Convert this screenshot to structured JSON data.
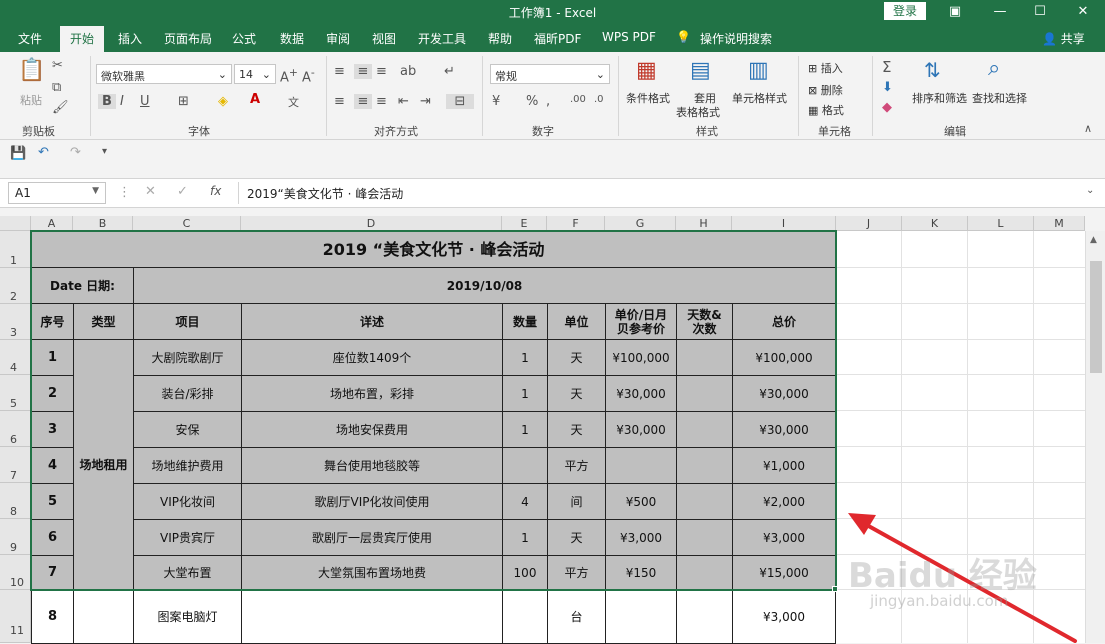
{
  "window": {
    "title": "工作簿1 - Excel",
    "login": "登录"
  },
  "tabs": [
    "文件",
    "开始",
    "插入",
    "页面布局",
    "公式",
    "数据",
    "审阅",
    "视图",
    "开发工具",
    "帮助",
    "福昕PDF",
    "WPS PDF",
    "操作说明搜索"
  ],
  "share": "共享",
  "ribbon": {
    "paste": "粘贴",
    "font_name": "微软雅黑",
    "font_size": "14",
    "number_format": "常规",
    "cond_format": "条件格式",
    "table_format_1": "套用",
    "table_format_2": "表格格式",
    "cell_style": "单元格样式",
    "insert": "插入",
    "delete": "删除",
    "format": "格式",
    "sort_filter": "排序和筛选",
    "find_select": "查找和选择",
    "groups": [
      "剪贴板",
      "字体",
      "对齐方式",
      "数字",
      "样式",
      "单元格",
      "编辑"
    ]
  },
  "formula_bar": {
    "name_box": "A1",
    "fx": "fx",
    "content": "2019“美食文化节 · 峰会活动"
  },
  "columns": [
    "A",
    "B",
    "C",
    "D",
    "E",
    "F",
    "G",
    "H",
    "I",
    "J",
    "K",
    "L",
    "M"
  ],
  "rows": [
    "1",
    "2",
    "3",
    "4",
    "5",
    "6",
    "7",
    "8",
    "9",
    "10",
    "11"
  ],
  "sheet": {
    "title": "2019 “美食文化节 · 峰会活动",
    "date_label": "Date   日期:",
    "date_value": "2019/10/08",
    "headers": [
      "序号",
      "类型",
      "项目",
      "详述",
      "数量",
      "单位",
      "单价/日月贝参考价",
      "天数&次数",
      "总价"
    ],
    "category": "场地租用",
    "items": [
      {
        "no": "1",
        "item": "大剧院歌剧厅",
        "detail": "座位数1409个",
        "qty": "1",
        "unit": "天",
        "price": "¥100,000",
        "days": "",
        "total": "¥100,000"
      },
      {
        "no": "2",
        "item": "装台/彩排",
        "detail": "场地布置，彩排",
        "qty": "1",
        "unit": "天",
        "price": "¥30,000",
        "days": "",
        "total": "¥30,000"
      },
      {
        "no": "3",
        "item": "安保",
        "detail": "场地安保费用",
        "qty": "1",
        "unit": "天",
        "price": "¥30,000",
        "days": "",
        "total": "¥30,000"
      },
      {
        "no": "4",
        "item": "场地维护费用",
        "detail": "舞台使用地毯胶等",
        "qty": "",
        "unit": "平方",
        "price": "",
        "days": "",
        "total": "¥1,000"
      },
      {
        "no": "5",
        "item": "VIP化妆间",
        "detail": "歌剧厅VIP化妆间使用",
        "qty": "4",
        "unit": "间",
        "price": "¥500",
        "days": "",
        "total": "¥2,000"
      },
      {
        "no": "6",
        "item": "VIP贵宾厅",
        "detail": "歌剧厅一层贵宾厅使用",
        "qty": "1",
        "unit": "天",
        "price": "¥3,000",
        "days": "",
        "total": "¥3,000"
      },
      {
        "no": "7",
        "item": "大堂布置",
        "detail": "大堂氛围布置场地费",
        "qty": "100",
        "unit": "平方",
        "price": "¥150",
        "days": "",
        "total": "¥15,000"
      },
      {
        "no": "8",
        "item": "图案电脑灯",
        "detail": "",
        "qty": "",
        "unit": "台",
        "price": "",
        "days": "",
        "total": "¥3,000"
      }
    ]
  },
  "watermark": {
    "brand": "Baidu 经验",
    "url": "jingyan.baidu.com"
  },
  "colors": {
    "excel_green": "#217346",
    "selection": "#217346",
    "arrow": "#e0282d"
  }
}
